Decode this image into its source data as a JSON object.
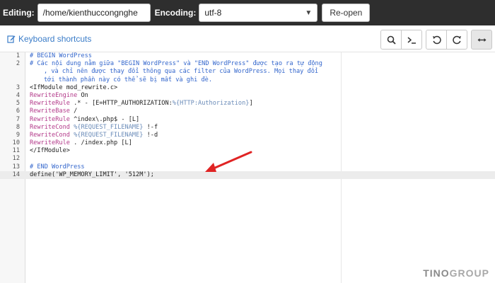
{
  "header": {
    "editing_label": "Editing:",
    "path_value": "/home/kienthuccongnghe",
    "encoding_label": "Encoding:",
    "encoding_value": "utf-8",
    "reopen_label": "Re-open"
  },
  "toolbar": {
    "keyboard_shortcuts": "Keyboard shortcuts"
  },
  "editor": {
    "lines": [
      {
        "num": "1",
        "text": "# BEGIN WordPress"
      },
      {
        "num": "2",
        "text": "# Các nội dung nằm giữa \"BEGIN WordPress\" và \"END WordPress\" được tạo ra tự động"
      },
      {
        "num": "",
        "text": ", và chỉ nên được thay đổi thông qua các filter của WordPress. Mọi thay đổi"
      },
      {
        "num": "",
        "text": "tới thành phần này có thể sẽ bị mất và ghi đè."
      },
      {
        "num": "3",
        "text": "<IfModule mod_rewrite.c>"
      },
      {
        "num": "4",
        "kw": "RewriteEngine",
        "rest": " On"
      },
      {
        "num": "5",
        "kw": "RewriteRule",
        "rest": " .* - [E=HTTP_AUTHORIZATION:",
        "var": "%{HTTP:Authorization}",
        "tail": "]"
      },
      {
        "num": "6",
        "kw": "RewriteBase",
        "rest": " /"
      },
      {
        "num": "7",
        "kw": "RewriteRule",
        "rest": " ^index\\.php$ - [L]"
      },
      {
        "num": "8",
        "kw": "RewriteCond",
        "rest": " ",
        "var": "%{REQUEST_FILENAME}",
        "tail": " !-f"
      },
      {
        "num": "9",
        "kw": "RewriteCond",
        "rest": " ",
        "var": "%{REQUEST_FILENAME}",
        "tail": " !-d"
      },
      {
        "num": "10",
        "kw": "RewriteRule",
        "rest": " . /index.php [L]"
      },
      {
        "num": "11",
        "text": "</IfModule>"
      },
      {
        "num": "12",
        "text": ""
      },
      {
        "num": "13",
        "text": "# END WordPress"
      },
      {
        "num": "14",
        "text": "define('WP_MEMORY_LIMIT', '512M');"
      }
    ]
  },
  "brand": {
    "part1": "TINO",
    "part2": "GROUP"
  },
  "colors": {
    "topbar": "#2e2e2e",
    "link": "#3a7cc8",
    "comment": "#3366cc",
    "keyword": "#b33a8a",
    "arrow": "#e02424"
  }
}
